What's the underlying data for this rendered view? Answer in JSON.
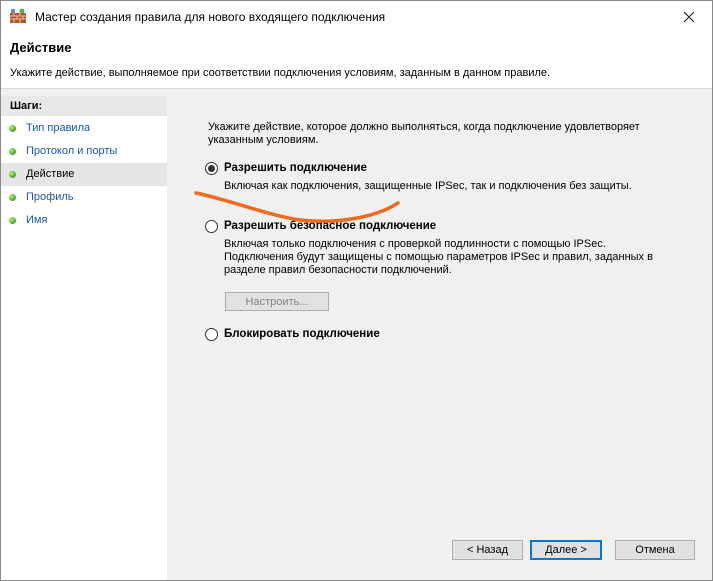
{
  "window": {
    "title": "Мастер создания правила для нового входящего подключения"
  },
  "header": {
    "title": "Действие",
    "description": "Укажите действие, выполняемое при соответствии подключения условиям, заданным в данном правиле."
  },
  "steps": {
    "title": "Шаги:",
    "items": [
      {
        "label": "Тип правила"
      },
      {
        "label": "Протокол и порты"
      },
      {
        "label": "Действие"
      },
      {
        "label": "Профиль"
      },
      {
        "label": "Имя"
      }
    ],
    "active_index": 2
  },
  "main": {
    "prompt": "Укажите действие, которое должно выполняться, когда подключение удовлетворяет указанным условиям.",
    "options": [
      {
        "label": "Разрешить подключение",
        "description": "Включая как подключения, защищенные IPSec, так и подключения без защиты.",
        "selected": true
      },
      {
        "label": "Разрешить безопасное подключение",
        "description": "Включая только подключения с проверкой подлинности с помощью IPSec. Подключения будут защищены с помощью параметров IPSec и правил, заданных в разделе правил безопасности подключений.",
        "selected": false
      },
      {
        "label": "Блокировать подключение",
        "description": "",
        "selected": false
      }
    ],
    "customize_label": "Настроить..."
  },
  "buttons": {
    "back": "< Назад",
    "next": "Далее >",
    "cancel": "Отмена"
  },
  "colors": {
    "annotation": "#f26a1b",
    "link": "#1a56b8",
    "accent": "#0078d7"
  }
}
